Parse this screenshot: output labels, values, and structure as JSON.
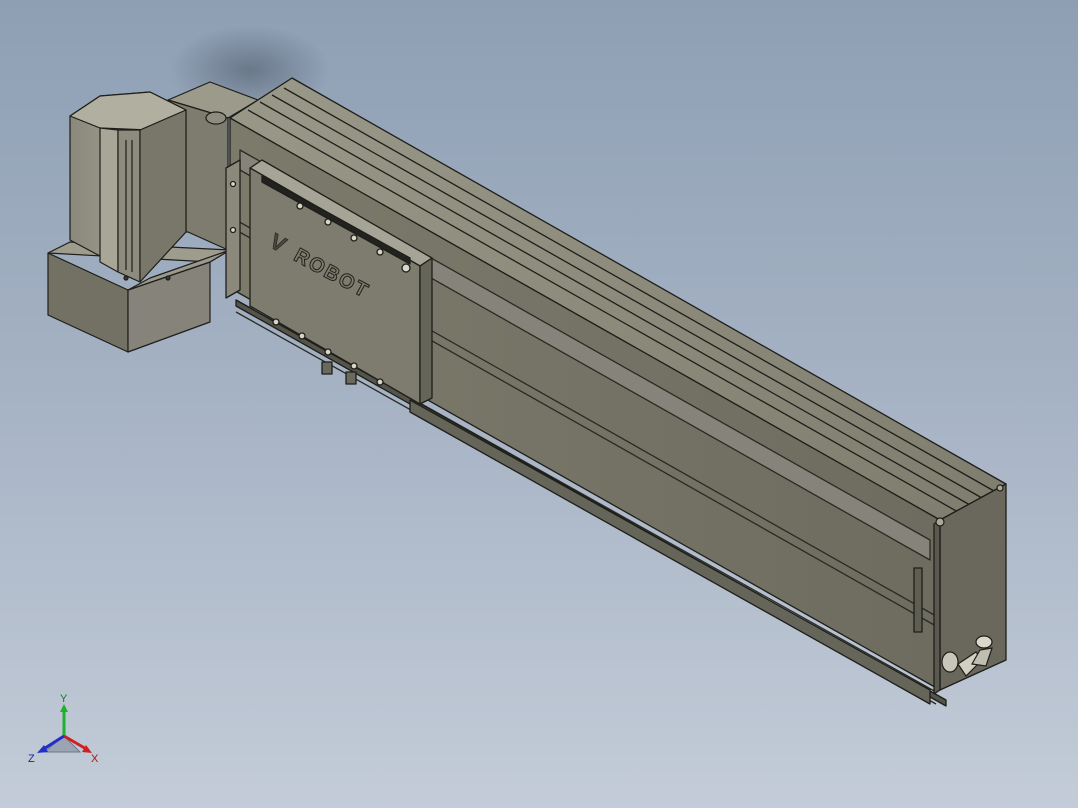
{
  "model": {
    "logo_text": "ROBOT",
    "logo_prefix": "V",
    "colors": {
      "background_top": "#8e9fb4",
      "background_bottom": "#c3ccd8",
      "body": "#7a7868",
      "body_light": "#918f7f",
      "body_dark": "#5e5d52",
      "edge": "#1e1e1a"
    }
  },
  "triad": {
    "y_label": "Y",
    "z_label": "Z",
    "x_label": "X",
    "colors": {
      "x": "#d02020",
      "y": "#20b030",
      "z": "#2030c8"
    }
  }
}
